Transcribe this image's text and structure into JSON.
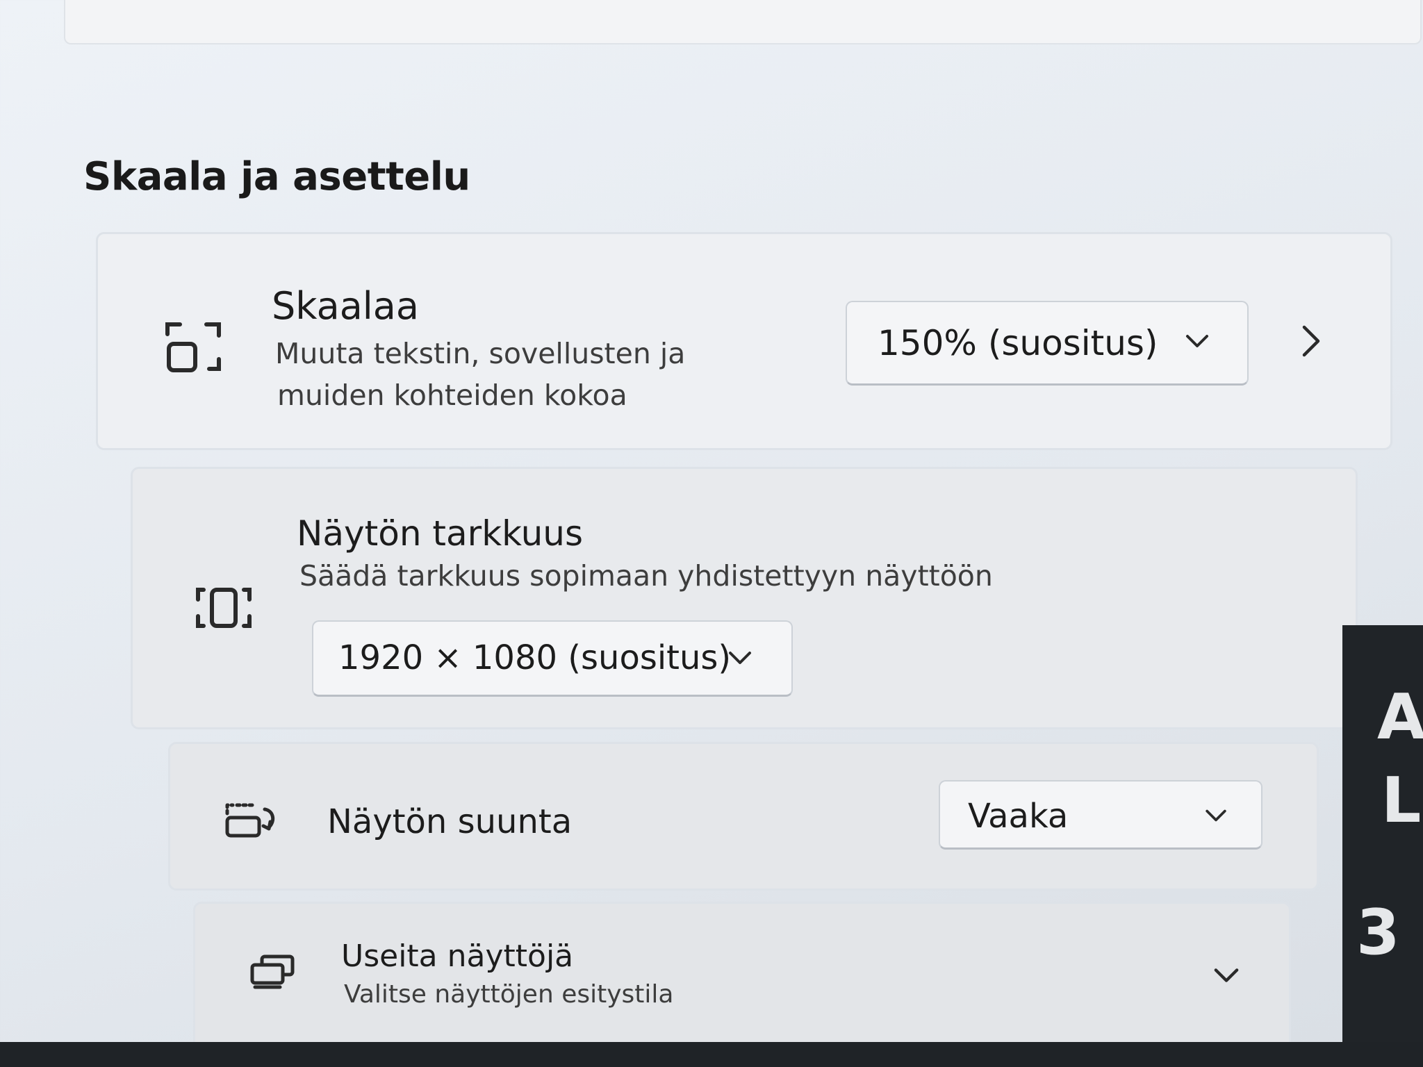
{
  "section": {
    "title": "Skaala ja asettelu"
  },
  "scale": {
    "title": "Skaalaa",
    "subtitle_line1": "Muuta tekstin, sovellusten ja",
    "subtitle_line2": "muiden kohteiden kokoa",
    "dropdown_value": "150% (suositus)",
    "icon": "scale-icon"
  },
  "resolution": {
    "title": "Näytön tarkkuus",
    "subtitle": "Säädä tarkkuus sopimaan yhdistettyyn näyttöön",
    "dropdown_value": "1920 × 1080 (suositus)",
    "icon": "resolution-icon"
  },
  "orientation": {
    "title": "Näytön suunta",
    "dropdown_value": "Vaaka",
    "icon": "orientation-icon"
  },
  "multiple_displays": {
    "title": "Useita näyttöjä",
    "subtitle": "Valitse näyttöjen esitystila",
    "icon": "multiple-displays-icon"
  },
  "background_glyphs": [
    "A",
    "L",
    "3"
  ],
  "colors": {
    "background": "#e8ecf1",
    "card": "#eef0f3",
    "text": "#1c1c1c",
    "subtext": "#3d3d3d"
  }
}
